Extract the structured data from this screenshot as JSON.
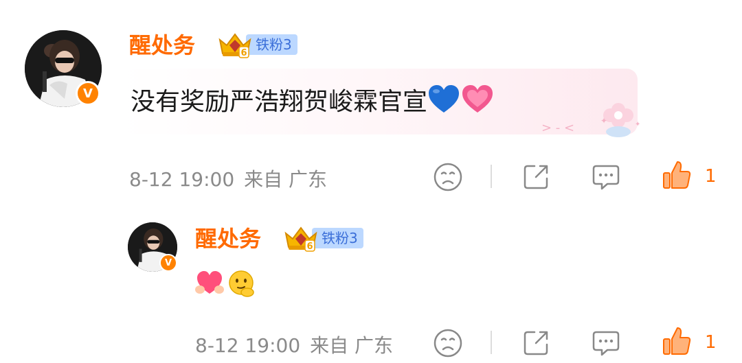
{
  "comment": {
    "username": "醒处务",
    "fan_badge": {
      "label": "铁粉3",
      "level": "6"
    },
    "text": "没有奖励严浩翔贺峻霖官宣",
    "emojis": [
      "blue-heart",
      "pink-heart"
    ],
    "date": "8-12 19:00",
    "location": "来自 广东",
    "like_count": "1"
  },
  "reply": {
    "username": "醒处务",
    "fan_badge": {
      "label": "铁粉3",
      "level": "6"
    },
    "emojis": [
      "heart-hands",
      "thinking-face"
    ],
    "date": "8-12 19:00",
    "location": "来自 广东",
    "like_count": "1"
  },
  "colors": {
    "username": "#ff6a00",
    "verified_badge": "#ff8200",
    "fan_badge_bg": "#bcd8ff",
    "like_active": "#ff6a00",
    "meta_text": "#8a8a8a"
  }
}
